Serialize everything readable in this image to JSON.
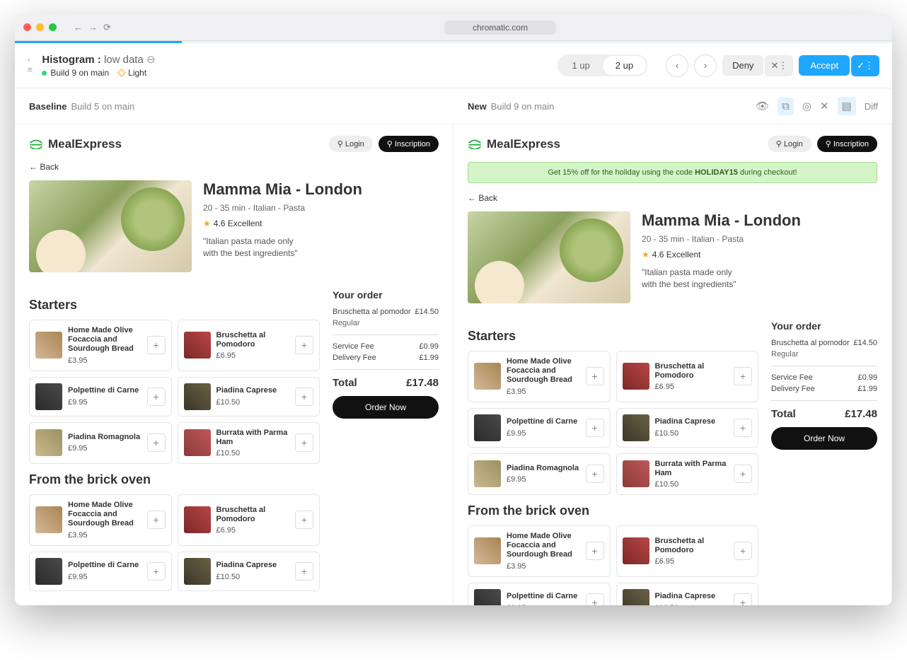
{
  "browser": {
    "url": "chromatic.com"
  },
  "header": {
    "story_name": "Histogram :",
    "story_variant": "low data",
    "build_line": "Build 9 on main",
    "theme": "Light",
    "toggle": {
      "one_up": "1 up",
      "two_up": "2 up"
    },
    "deny": "Deny",
    "accept": "Accept"
  },
  "compare": {
    "baseline_label": "Baseline",
    "baseline_build": "Build 5 on main",
    "new_label": "New",
    "new_build": "Build 9 on main",
    "diff_label": "Diff"
  },
  "app": {
    "brand": "MealExpress",
    "login": "Login",
    "signup": "Inscription",
    "back": "Back",
    "promo_prefix": "Get 15% off for the holiday using the code ",
    "promo_code": "HOLIDAY15",
    "promo_suffix": " during checkout!"
  },
  "restaurant": {
    "name": "Mamma Mia - London",
    "meta": "20 - 35 min - Italian - Pasta",
    "rating": "4.6 Excellent",
    "desc1": "\"Italian pasta made only",
    "desc2": "with the best ingredients\""
  },
  "sections": {
    "starters": "Starters",
    "oven": "From the brick oven"
  },
  "starters": [
    {
      "name": "Home Made Olive Focaccia and Sourdough Bread",
      "price": "£3.95",
      "thumb": "th-1"
    },
    {
      "name": "Bruschetta al Pomodoro",
      "price": "£6.95",
      "thumb": "th-2"
    },
    {
      "name": "Polpettine di Carne",
      "price": "£9.95",
      "thumb": "th-3"
    },
    {
      "name": "Piadina Caprese",
      "price": "£10.50",
      "thumb": "th-4"
    },
    {
      "name": "Piadina Romagnola",
      "price": "£9.95",
      "thumb": "th-5"
    },
    {
      "name": "Burrata with Parma Ham",
      "price": "£10.50",
      "thumb": "th-6"
    }
  ],
  "oven_items": [
    {
      "name": "Home Made Olive Focaccia and Sourdough Bread",
      "price": "£3.95",
      "thumb": "th-1"
    },
    {
      "name": "Bruschetta al Pomodoro",
      "price": "£6.95",
      "thumb": "th-2"
    },
    {
      "name": "Polpettine di Carne",
      "price": "£9.95",
      "thumb": "th-3"
    },
    {
      "name": "Piadina Caprese",
      "price": "£10.50",
      "thumb": "th-4"
    }
  ],
  "order": {
    "title": "Your order",
    "item": "Bruschetta al pomodor",
    "item_price": "£14.50",
    "variant": "Regular",
    "service_label": "Service Fee",
    "service_price": "£0.99",
    "delivery_label": "Delivery Fee",
    "delivery_price": "£1.99",
    "total_label": "Total",
    "total_price": "£17.48",
    "button": "Order Now"
  }
}
